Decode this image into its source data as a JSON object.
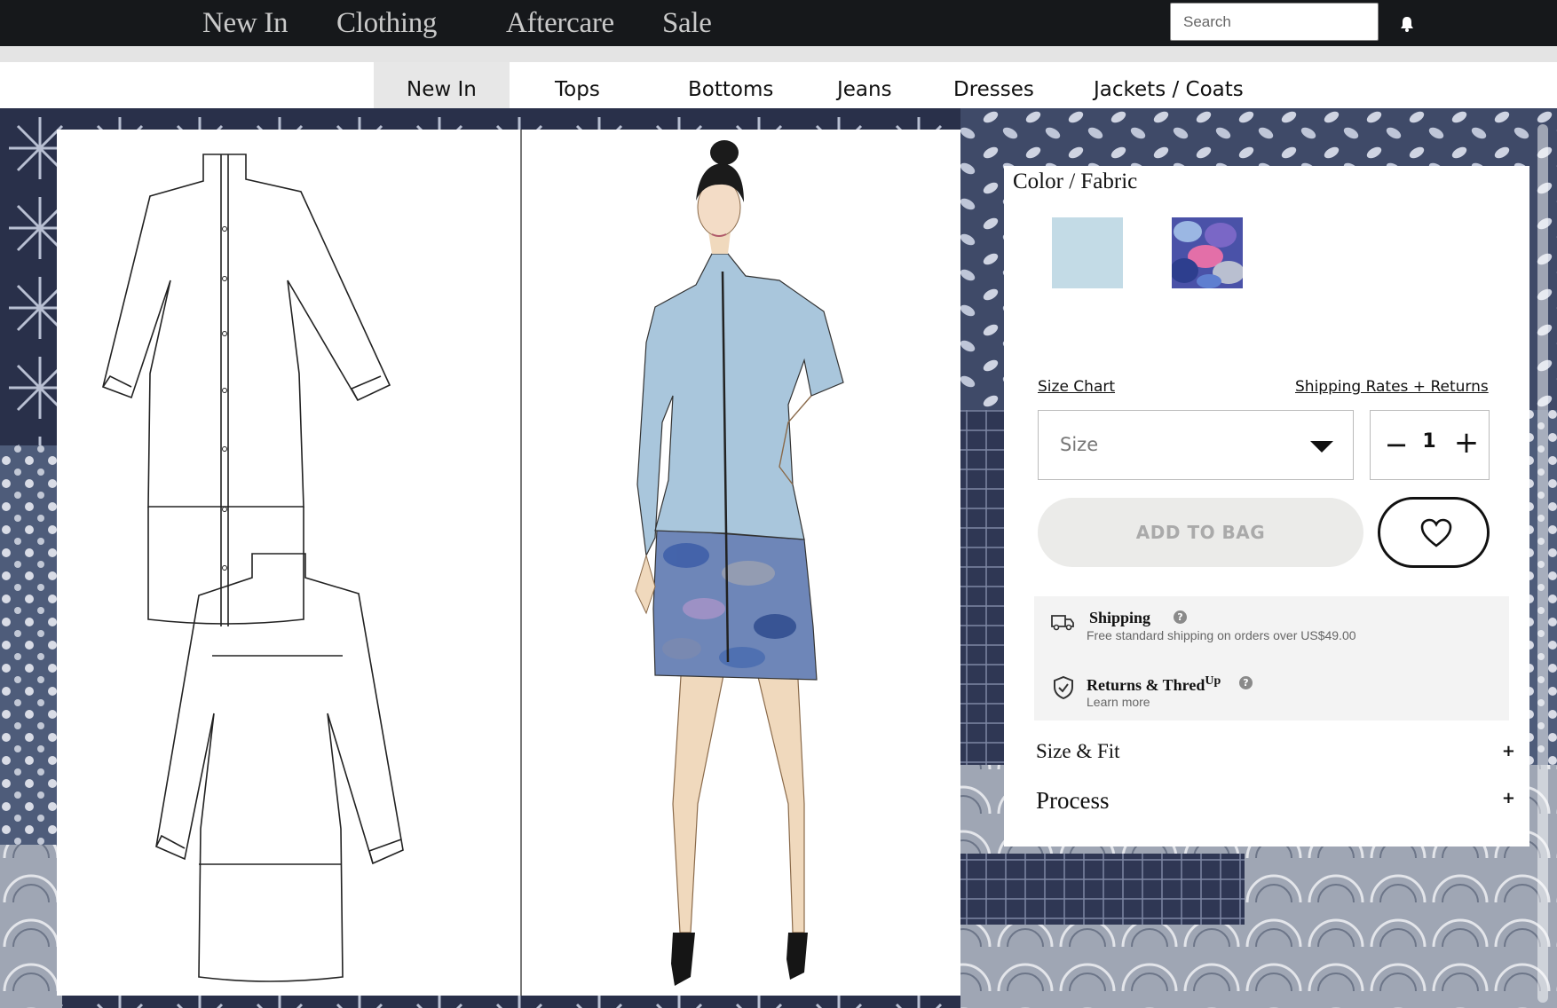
{
  "top_nav": {
    "links": [
      "New In",
      "Clothing",
      "Aftercare",
      "Sale"
    ],
    "search_placeholder": "Search",
    "bell_icon": "bell-icon"
  },
  "sub_nav": {
    "tabs": [
      "New In",
      "Tops",
      "Bottoms",
      "Jeans",
      "Dresses",
      "Jackets / Coats"
    ],
    "active_tab": "New In"
  },
  "product": {
    "color_fabric_label": "Color / Fabric",
    "swatches": [
      {
        "name": "light-blue",
        "color": "#c3dbe6"
      },
      {
        "name": "blue-floral-print",
        "color": "#4a52a8"
      }
    ],
    "size_chart_link": "Size Chart",
    "shipping_returns_link": "Shipping Rates + Returns",
    "size_select": "Size",
    "quantity": "1",
    "add_to_bag": "ADD TO BAG",
    "shipping": {
      "title": "Shipping",
      "subtitle": "Free standard shipping on orders over US$49.00"
    },
    "returns": {
      "title": "Returns & Thred",
      "title_sup": "Up",
      "subtitle": "Learn more"
    },
    "accordions": [
      {
        "label": "Size & Fit",
        "icon": "+"
      },
      {
        "label": "Process",
        "icon": "+"
      }
    ]
  },
  "colors": {
    "nav_bg": "#16181b",
    "nav_text": "#c9c9c9",
    "active_tab_bg": "#e7e7e7",
    "button_disabled_bg": "#ebebe9"
  }
}
